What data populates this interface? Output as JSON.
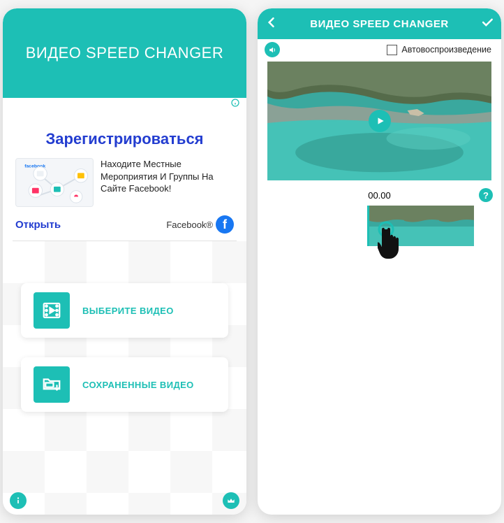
{
  "left": {
    "appTitle": "ВИДЕО SPEED CHANGER",
    "ad": {
      "title": "Зарегистрироваться",
      "body": "Находите Местные Мероприятия И Группы На Сайте Facebook!",
      "openLabel": "Открыть",
      "brand": "Facebook®"
    },
    "menu": {
      "select": "ВЫБЕРИТЕ ВИДЕО",
      "saved": "СОХРАНЕННЫЕ ВИДЕО"
    }
  },
  "right": {
    "appTitle": "ВИДЕО SPEED CHANGER",
    "autoplayLabel": "Автовоспроизведение",
    "time": "00.00",
    "helpGlyph": "?"
  }
}
